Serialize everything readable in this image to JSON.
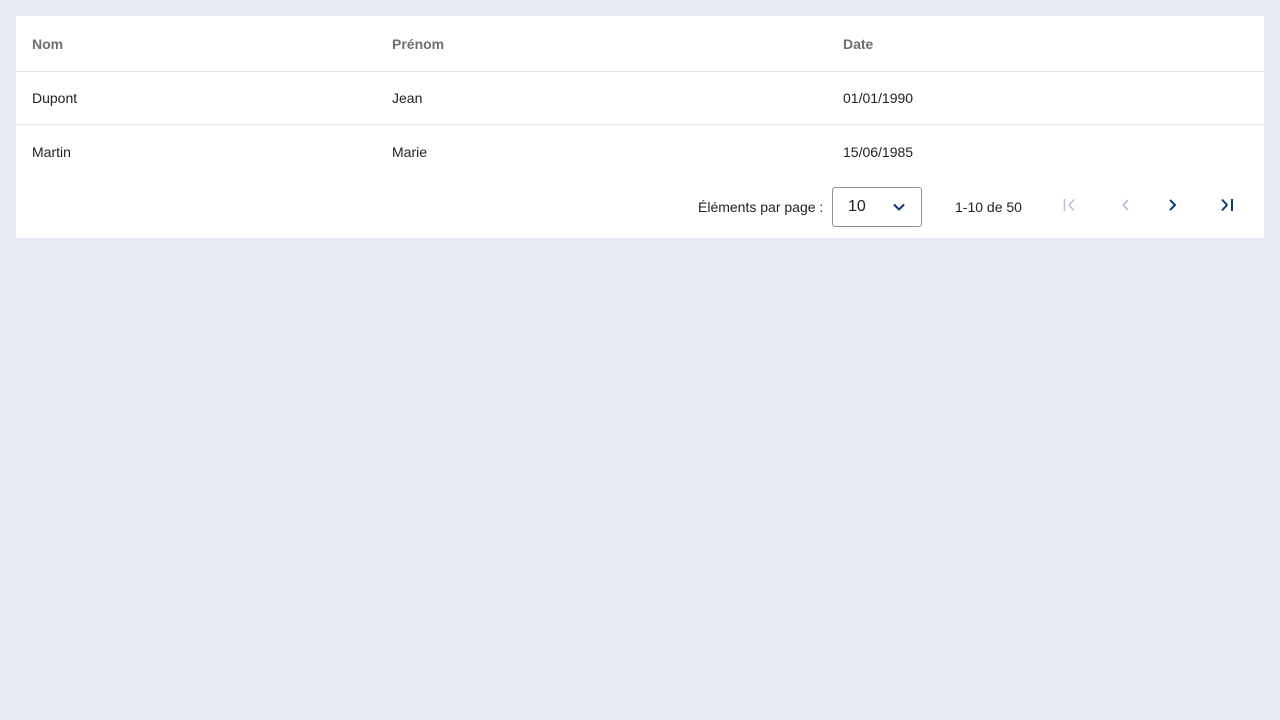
{
  "table": {
    "headers": [
      "Nom",
      "Prénom",
      "Date"
    ],
    "rows": [
      [
        "Dupont",
        "Jean",
        "01/01/1990"
      ],
      [
        "Martin",
        "Marie",
        "15/06/1985"
      ]
    ]
  },
  "paginator": {
    "items_per_page_label": "Éléments par page :",
    "page_size": "10",
    "range_label": "1-10 de 50",
    "icons": {
      "first": "first-page-icon",
      "previous": "chevron-left-icon",
      "next": "chevron-right-icon",
      "last": "last-page-icon",
      "dropdown": "chevron-down-icon"
    },
    "colors": {
      "enabled": "#0b3a82",
      "disabled": "#b7c1d6"
    }
  }
}
